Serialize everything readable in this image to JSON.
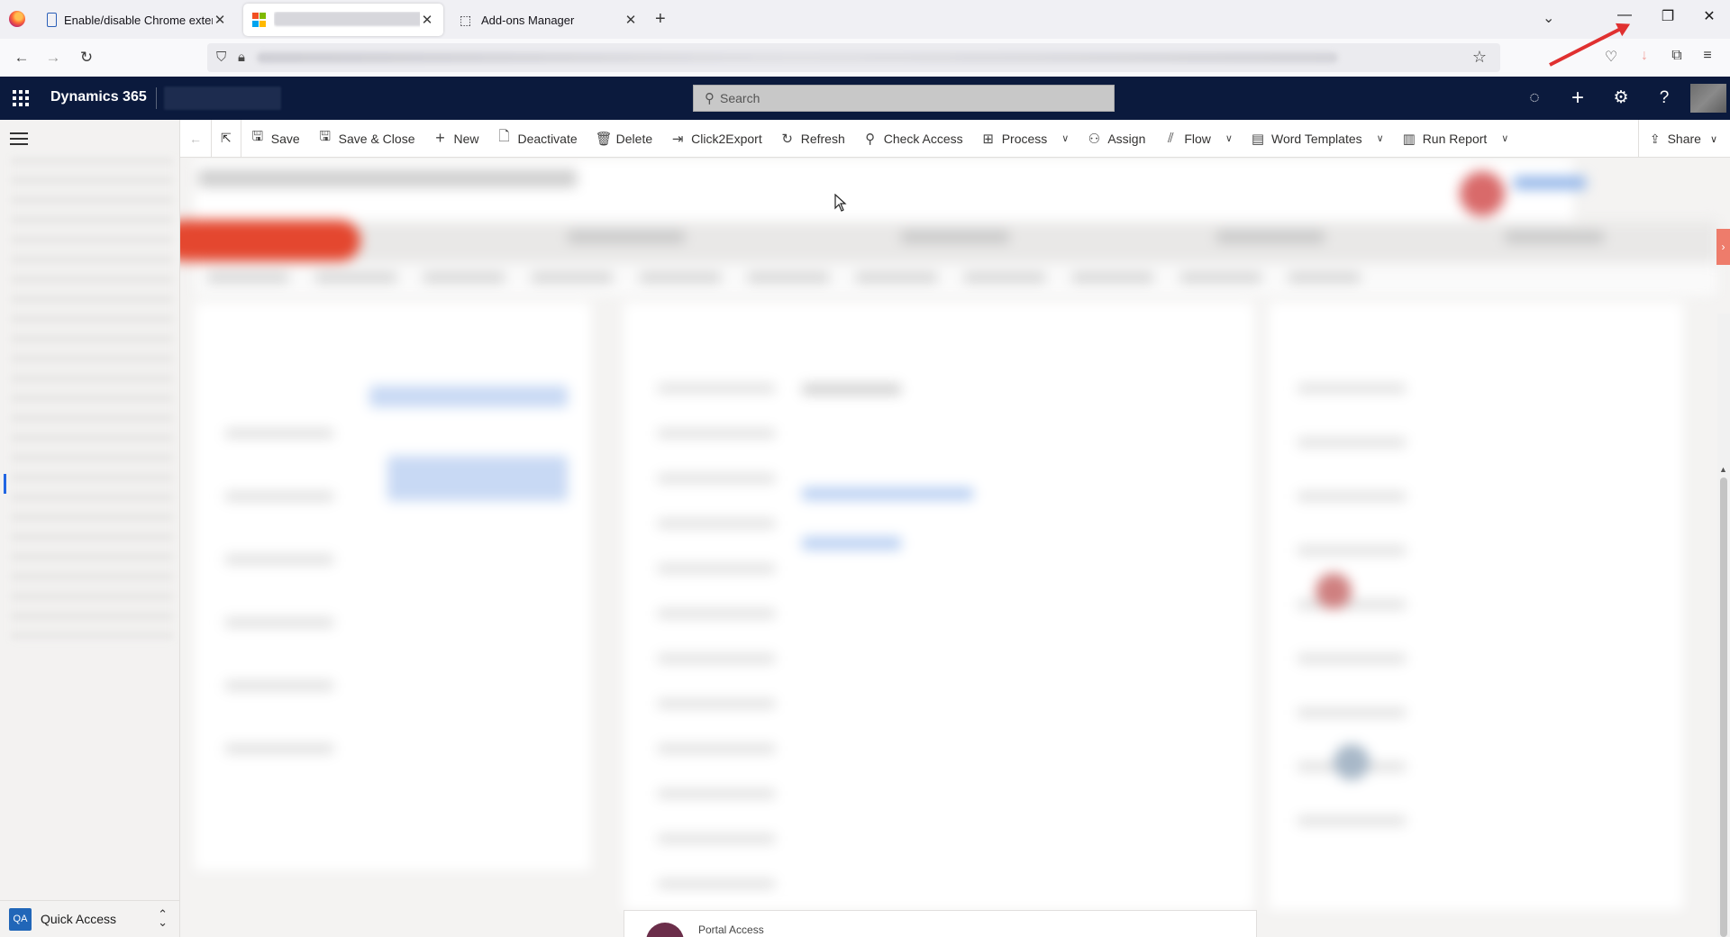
{
  "browser": {
    "tabs": [
      {
        "title": "Enable/disable Chrome extensio",
        "close": "✕"
      },
      {
        "title": "",
        "close": "✕"
      },
      {
        "title": "Add-ons Manager",
        "close": "✕"
      }
    ],
    "new_tab": "+",
    "list_tabs": "⌄",
    "window_controls": {
      "minimize": "—",
      "restore": "❐",
      "close": "✕"
    },
    "nav": {
      "back": "←",
      "forward": "→",
      "reload": "↻"
    },
    "bookmark_star": "☆"
  },
  "app": {
    "name": "Dynamics 365",
    "search_placeholder": "Search",
    "header_icons": {
      "lightbulb": "💡",
      "add": "+",
      "settings": "⚙",
      "help": "?"
    }
  },
  "sitemap": {
    "quick_access": {
      "badge": "QA",
      "label": "Quick Access"
    }
  },
  "commands": {
    "save": "Save",
    "save_close": "Save & Close",
    "new": "New",
    "deactivate": "Deactivate",
    "delete": "Delete",
    "click2export": "Click2Export",
    "refresh": "Refresh",
    "check_access": "Check Access",
    "process": "Process",
    "assign": "Assign",
    "flow": "Flow",
    "word_templates": "Word Templates",
    "run_report": "Run Report",
    "share": "Share"
  },
  "form": {
    "portal_access": "Portal Access"
  },
  "colors": {
    "app_header": "#0b1a3d",
    "accent": "#2266e3",
    "annotation_arrow": "#e03030"
  }
}
